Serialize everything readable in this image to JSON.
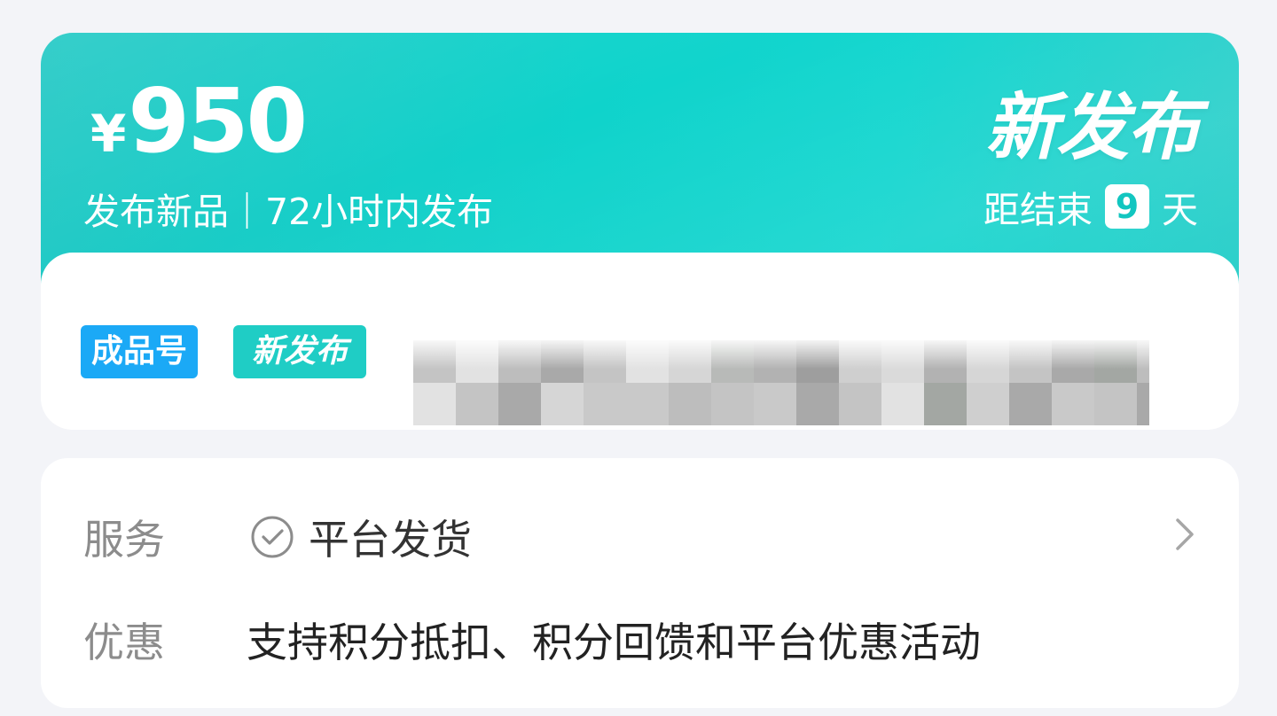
{
  "banner": {
    "currency": "¥",
    "price": "950",
    "subtitle": "发布新品｜72小时内发布",
    "title": "新发布",
    "countdown_prefix": "距结束",
    "countdown_days": "9",
    "countdown_suffix": "天"
  },
  "tags": {
    "product": "成品号",
    "new": "新发布"
  },
  "service": {
    "label": "服务",
    "value": "平台发货",
    "icon": "check-circle-icon",
    "chevron_icon": "chevron-right-icon"
  },
  "discount": {
    "label": "优惠",
    "value": "支持积分抵扣、积分回馈和平台优惠活动"
  },
  "colors": {
    "banner": "#14d3cb",
    "tag_product": "#1ba9f6",
    "tag_new": "#1fcdc5",
    "background": "#f3f4f8"
  }
}
